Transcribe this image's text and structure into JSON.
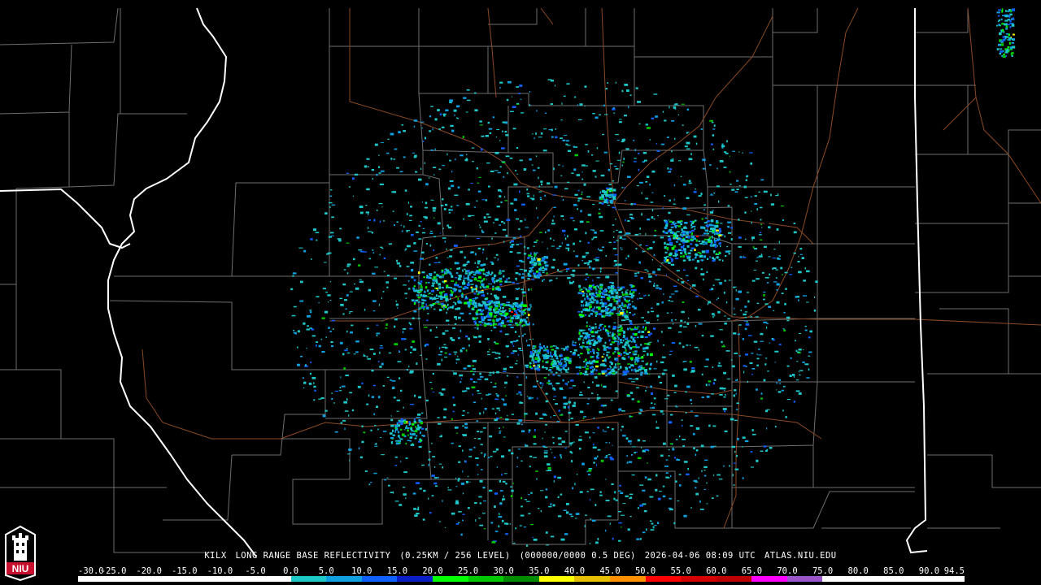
{
  "caption": {
    "station": "KILX",
    "product": "LONG RANGE BASE REFLECTIVITY",
    "resolution": "(0.25KM / 256 LEVEL)",
    "volume": "(000000/0000 0.5 DEG)",
    "timestamp": "2026-04-06 08:09 UTC",
    "source": "ATLAS.NIU.EDU"
  },
  "logo": {
    "text": "NIU",
    "icon": "niu-altgeld-tower-logo-icon",
    "color": "#c8102e"
  },
  "scale": {
    "labels": [
      "-30.0",
      "-25.0",
      "-20.0",
      "-15.0",
      "-10.0",
      "-5.0",
      "0.0",
      "5.0",
      "10.0",
      "15.0",
      "20.0",
      "25.0",
      "30.0",
      "35.0",
      "40.0",
      "45.0",
      "50.0",
      "55.0",
      "60.0",
      "65.0",
      "70.0",
      "75.0",
      "80.0",
      "85.0",
      "90.0",
      "94.5"
    ],
    "colors": [
      "#ffffff",
      "#ffffff",
      "#ffffff",
      "#ffffff",
      "#ffffff",
      "#ffffff",
      "#1fc8c8",
      "#10a0e0",
      "#1060ff",
      "#0a1ec8",
      "#00ff00",
      "#00c800",
      "#008c00",
      "#ffff00",
      "#e6c000",
      "#ff9000",
      "#ff0000",
      "#d40000",
      "#bc0000",
      "#ff00ff",
      "#9955c9",
      "#ffffff",
      "#ffffff",
      "#ffffff",
      "#ffffff"
    ]
  },
  "map": {
    "background": "#000000",
    "county_line_color": "#6e6e6e",
    "state_line_color": "#ffffff",
    "highway_color": "#8b4a26",
    "echo_colors": [
      "#1fc8c8",
      "#10a0e0",
      "#1060ff",
      "#00c800",
      "#00ff00",
      "#ffff00",
      "#ff0000"
    ]
  }
}
